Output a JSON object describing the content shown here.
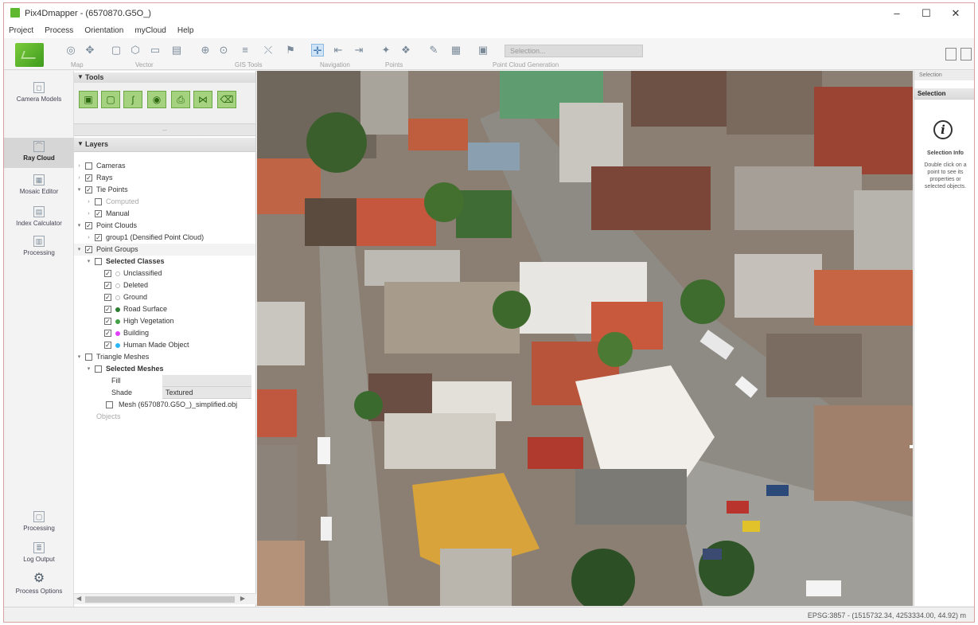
{
  "window": {
    "title": "Pix4Dmapper - (6570870.G5O_)",
    "minimize": "–",
    "maximize": "☐",
    "close": "✕"
  },
  "menu": [
    "Project",
    "Process",
    "Orientation",
    "myCloud",
    "Help"
  ],
  "toolbar": {
    "groups": [
      "Map",
      "Vector",
      "GIS Tools",
      "Navigation",
      "Points",
      "Point Cloud Generation"
    ],
    "combo_value": "Selection..."
  },
  "sidebar": [
    {
      "label": "Camera Models",
      "icon": "camera-icon"
    },
    {
      "label": "Ray Cloud",
      "icon": "cloud-icon"
    },
    {
      "label": "Mosaic Editor",
      "icon": "mosaic-icon"
    },
    {
      "label": "Index Calculator",
      "icon": "calculator-icon"
    },
    {
      "label": "Processing",
      "icon": "processing-icon"
    },
    {
      "label": "Log Output",
      "icon": "log-icon"
    },
    {
      "label": "Process Options",
      "icon": "gear-icon"
    }
  ],
  "panels": {
    "tools_title": "Tools",
    "tools_sep": "...",
    "layers_title": "Layers"
  },
  "layers": [
    {
      "label": "Cameras",
      "level": 0,
      "checked": false,
      "expand": "+"
    },
    {
      "label": "Rays",
      "level": 0,
      "checked": true,
      "expand": "+"
    },
    {
      "label": "Tie Points",
      "level": 0,
      "checked": true,
      "expand": "-"
    },
    {
      "label": "Computed",
      "level": 1,
      "checked": false,
      "expand": "+",
      "gray": true
    },
    {
      "label": "Manual",
      "level": 1,
      "checked": true,
      "expand": "+"
    },
    {
      "label": "Point Clouds",
      "level": 0,
      "checked": true,
      "expand": "-"
    },
    {
      "label": "group1 (Densified Point Cloud)",
      "level": 1,
      "checked": true,
      "expand": "+"
    },
    {
      "label": "Point Groups",
      "level": 0,
      "checked": true,
      "expand": "-",
      "shaded": true
    },
    {
      "label": "Selected Classes",
      "level": 1,
      "checked": false,
      "expand": "-",
      "bold": true
    },
    {
      "label": "Unclassified",
      "level": 2,
      "checked": true,
      "dot": "#ffffff"
    },
    {
      "label": "Deleted",
      "level": 2,
      "checked": true,
      "dot": "#ffffff"
    },
    {
      "label": "Ground",
      "level": 2,
      "checked": true,
      "dot": "#ffffff"
    },
    {
      "label": "Road Surface",
      "level": 2,
      "checked": true,
      "dot": "#2e7d32"
    },
    {
      "label": "High Vegetation",
      "level": 2,
      "checked": true,
      "dot": "#43a047"
    },
    {
      "label": "Building",
      "level": 2,
      "checked": true,
      "dot": "#e040fb"
    },
    {
      "label": "Human Made Object",
      "level": 2,
      "checked": true,
      "dot": "#29b6f6"
    },
    {
      "label": "Triangle Meshes",
      "level": 0,
      "checked": false,
      "expand": "-"
    },
    {
      "label": "Selected Meshes",
      "level": 1,
      "checked": false,
      "expand": "-",
      "bold": true
    }
  ],
  "mesh_props": [
    {
      "key": "Fill",
      "value": ""
    },
    {
      "key": "Shade",
      "value": "Textured"
    }
  ],
  "mesh_item": "Mesh (6570870.G5O_)_simplified.obj",
  "objects_row": "Objects",
  "right_panel": {
    "top": "Selection",
    "head": "Selection",
    "info_title": "Selection Info",
    "info_body": "Double click on a point to see its properties or selected objects."
  },
  "status": "EPSG:3857 - (1515732.34, 4253334.00, 44.92) m"
}
